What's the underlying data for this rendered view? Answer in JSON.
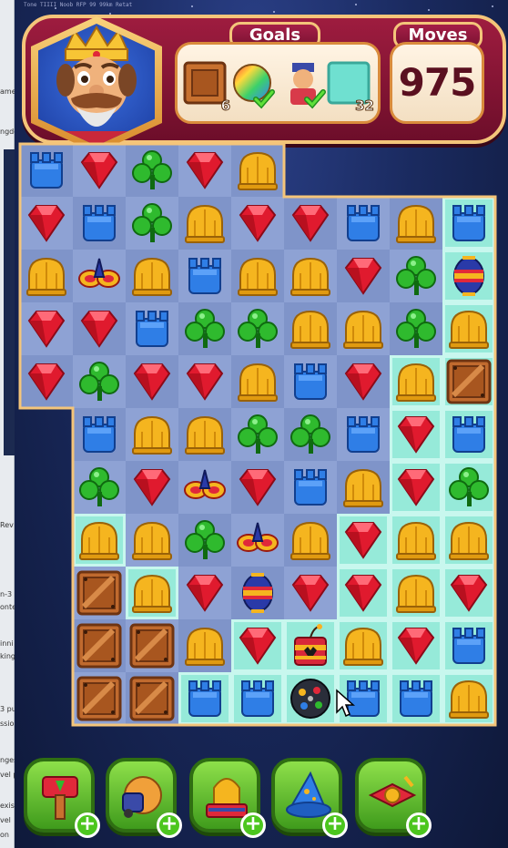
{
  "header": {
    "goals_label": "Goals",
    "moves_label": "Moves",
    "moves_value": "975",
    "goals": [
      {
        "item": "wooden-crate",
        "count": "6"
      },
      {
        "item": "rainbow-ball",
        "count": "",
        "done": true
      },
      {
        "item": "character",
        "count": "",
        "done": true
      },
      {
        "item": "ice-tile",
        "count": "32"
      }
    ]
  },
  "overlay_text": "Tone TIIII Noob RFP 99 99km Retat",
  "left_fragments": [
    "ame",
    "ngdo",
    "Rev",
    "n-3 c",
    "onte",
    "inni",
    "king",
    "3 pu",
    "ssion",
    "nges",
    "vel p",
    "exis",
    "vel",
    "on"
  ],
  "board": {
    "cols": 9,
    "rows": 11,
    "legend": {
      "R": "red-gem",
      "B": "blue-tower",
      "G": "green-clover",
      "Y": "yellow-dome",
      "C": "wooden-crate",
      "P": "propeller-bomb",
      "L": "lantern-bomb",
      "D": "dynamite",
      "S": "disco-ball",
      "_": "empty"
    },
    "grid": [
      "BRGRY____",
      "RBGYRRBYB",
      "YPYBYYRGL",
      "RRBGGYYGY",
      "RGRRYBRYC",
      "_BYYGGBRB",
      "_GRPRBYRG",
      "_YYGPYRYY",
      "_CYRLRRYR",
      "_CCYRDYRB",
      "_CCBBSBBY"
    ],
    "ice": [
      [
        1,
        8
      ],
      [
        2,
        8
      ],
      [
        3,
        8
      ],
      [
        4,
        7
      ],
      [
        4,
        8
      ],
      [
        5,
        7
      ],
      [
        5,
        8
      ],
      [
        6,
        7
      ],
      [
        6,
        8
      ],
      [
        7,
        1
      ],
      [
        7,
        6
      ],
      [
        7,
        7
      ],
      [
        7,
        8
      ],
      [
        8,
        2
      ],
      [
        8,
        6
      ],
      [
        8,
        7
      ],
      [
        8,
        8
      ],
      [
        9,
        4
      ],
      [
        9,
        5
      ],
      [
        9,
        6
      ],
      [
        9,
        7
      ],
      [
        9,
        8
      ],
      [
        10,
        3
      ],
      [
        10,
        4
      ],
      [
        10,
        5
      ],
      [
        10,
        6
      ],
      [
        10,
        7
      ],
      [
        10,
        8
      ]
    ]
  },
  "boosters": [
    {
      "name": "hammer",
      "plus": "+"
    },
    {
      "name": "glove",
      "plus": "+"
    },
    {
      "name": "anvil",
      "plus": "+"
    },
    {
      "name": "wizard-hat",
      "plus": "+"
    },
    {
      "name": "jester",
      "plus": "+"
    }
  ],
  "colors": {
    "red": "#e01a2e",
    "blue": "#2f7ee6",
    "green": "#2fba2e",
    "yellow": "#f5b51f",
    "crate": "#c06a2e",
    "header": "#8b1634",
    "gold": "#f4c57a"
  }
}
